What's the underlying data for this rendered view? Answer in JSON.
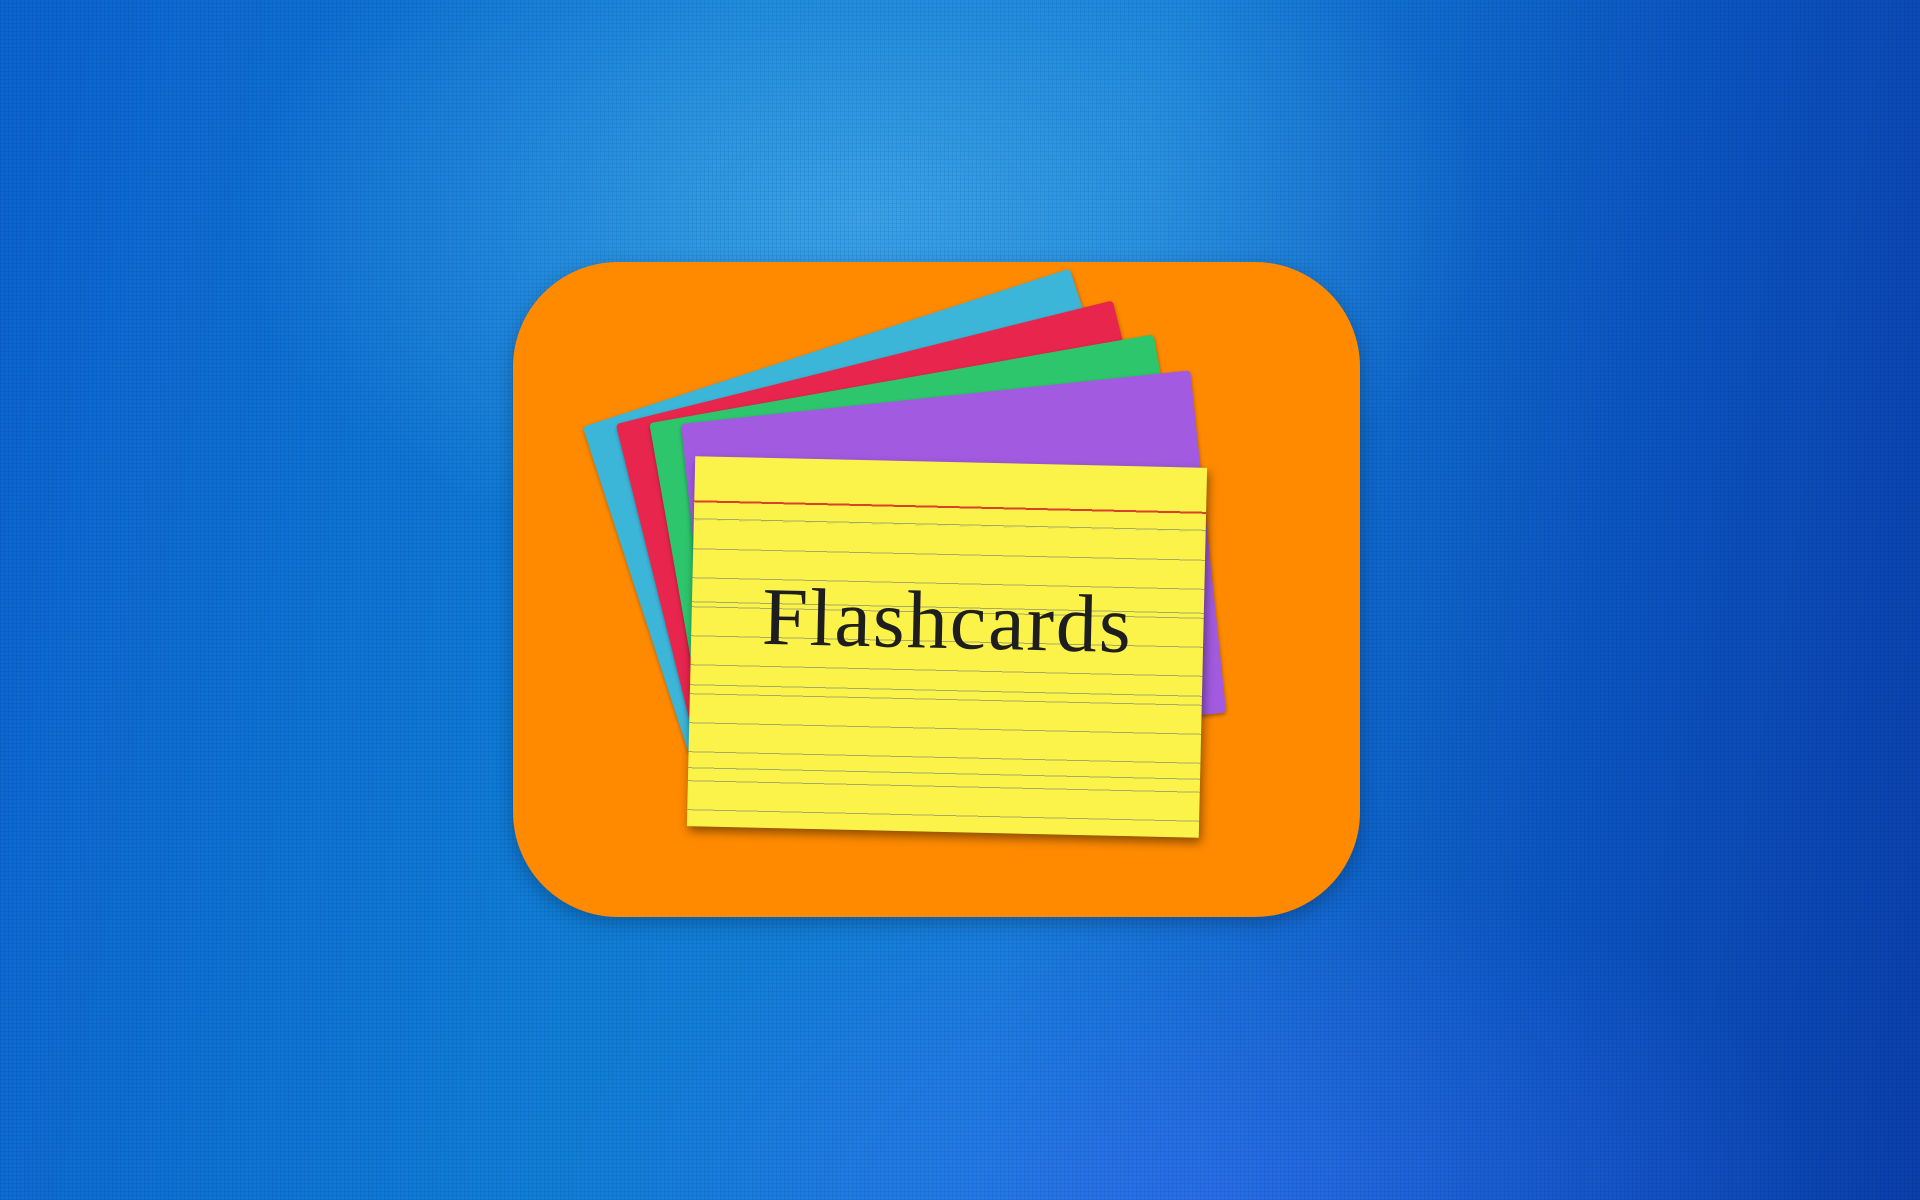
{
  "icon": {
    "card_title": "Flashcards"
  },
  "colors": {
    "background": "#137fdb",
    "icon_background": "#ff8a00",
    "card_front": "#fbf24a",
    "card_blue": "#3cb6d8",
    "card_red": "#e8254d",
    "card_green": "#2ec66c",
    "card_purple": "#a25be0"
  }
}
